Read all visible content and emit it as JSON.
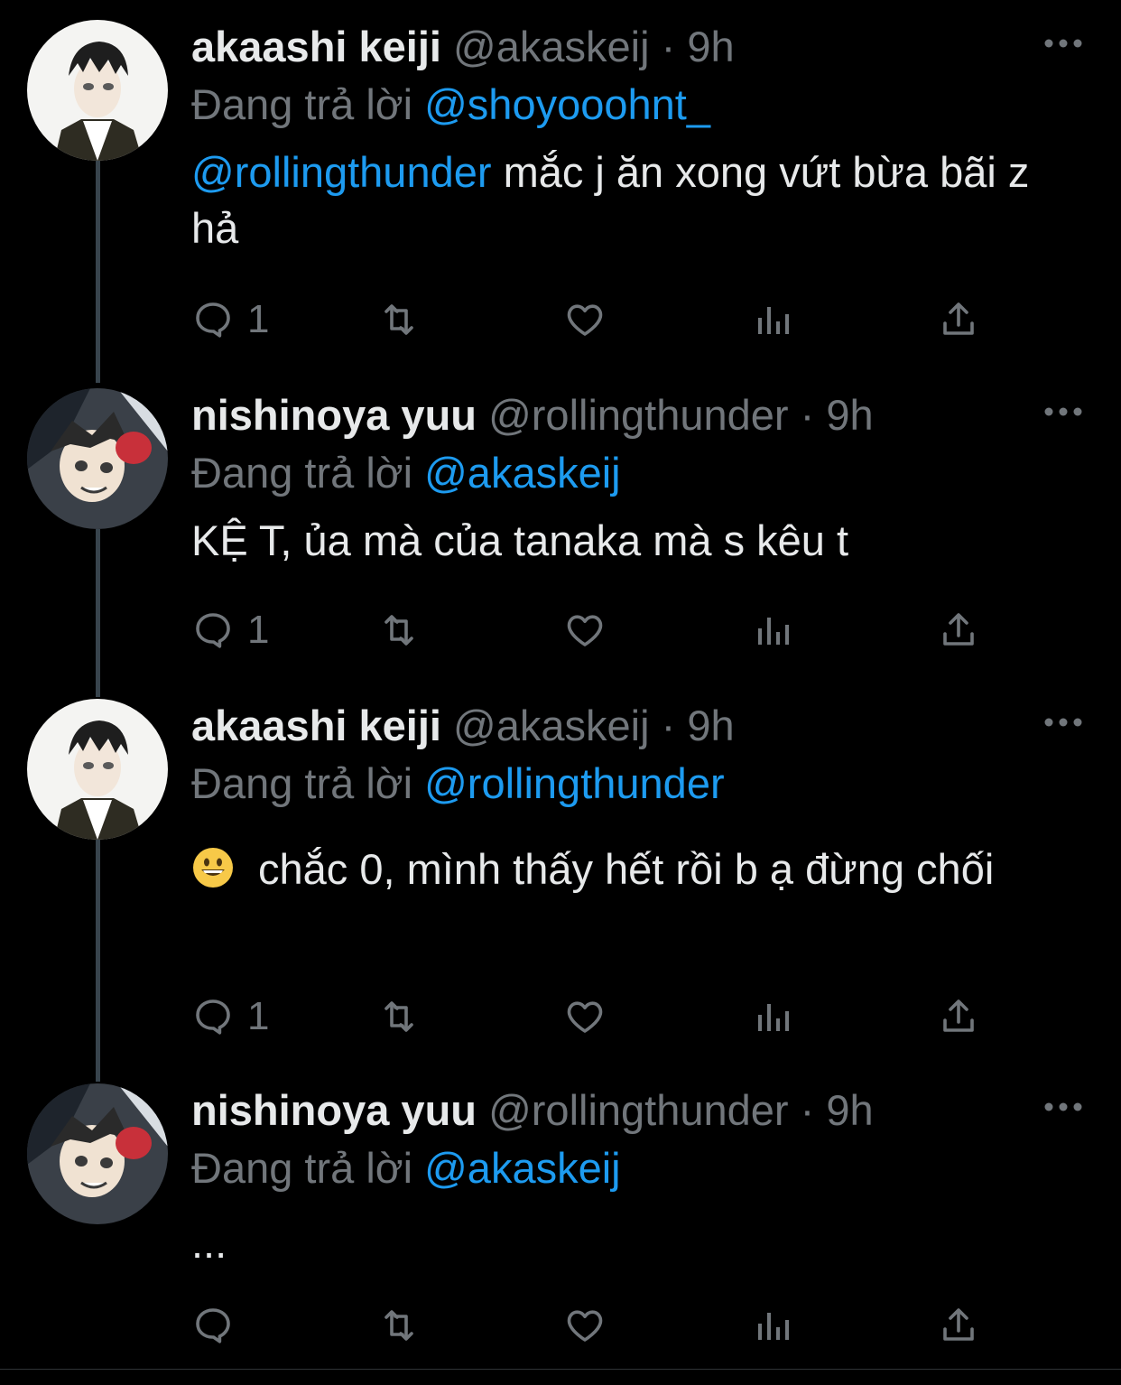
{
  "tweets": [
    {
      "name": "akaashi keiji",
      "handle": "@akaskeij",
      "dot": "·",
      "time": "9h",
      "reply_label": "Đang trả lời",
      "reply_to": "@shoyooohnt_",
      "body_mention": "@rollingthunder",
      "body_text": " mắc j ăn xong vứt bừa bãi z hả",
      "reply_count": "1",
      "avatar": "akaashi"
    },
    {
      "name": "nishinoya yuu",
      "handle": "@rollingthunder",
      "dot": "·",
      "time": "9h",
      "reply_label": "Đang trả lời",
      "reply_to": "@akaskeij",
      "body_text": "KỆ T, ủa mà của tanaka mà s kêu t",
      "reply_count": "1",
      "avatar": "nishinoya"
    },
    {
      "name": "akaashi keiji",
      "handle": "@akaskeij",
      "dot": "·",
      "time": "9h",
      "reply_label": "Đang trả lời",
      "reply_to": "@rollingthunder",
      "body_text": "chắc 0, mình thấy hết rồi b ạ đừng chối",
      "reply_count": "1",
      "avatar": "akaashi"
    },
    {
      "name": "nishinoya yuu",
      "handle": "@rollingthunder",
      "dot": "·",
      "time": "9h",
      "reply_label": "Đang trả lời",
      "reply_to": "@akaskeij",
      "body_text": "...",
      "reply_count": "",
      "avatar": "nishinoya"
    }
  ],
  "icons": {
    "reply": "reply-icon",
    "retweet": "retweet-icon",
    "like": "heart-icon",
    "views": "views-icon",
    "share": "share-icon",
    "more": "more-icon",
    "emoji": "grinning-face-emoji"
  },
  "colors": {
    "background": "#000000",
    "text": "#e7e9ea",
    "muted": "#71767b",
    "link": "#1d9bf0",
    "thread_line": "#38444d"
  }
}
